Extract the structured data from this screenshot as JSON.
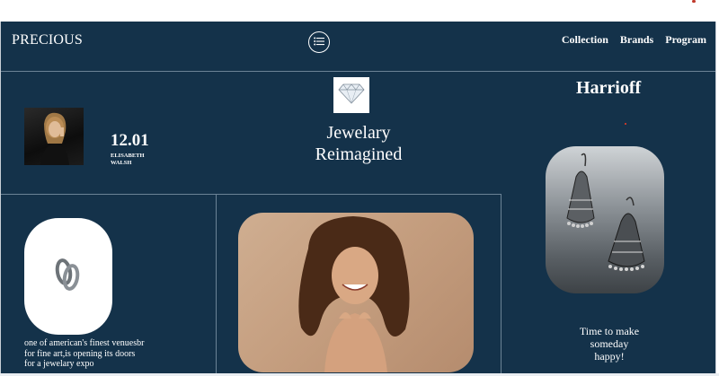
{
  "navbar": {
    "brand": "PRECIOUS",
    "links": [
      "Collection",
      "Brands",
      "Program"
    ]
  },
  "hero": {
    "title_line1": "Jewelary",
    "title_line2": "Reimagined"
  },
  "profile": {
    "number": "12.01",
    "name_line1": "ELISABETH",
    "name_line2": "WALSH"
  },
  "brand_feature": {
    "name": "Harrioff",
    "caption_line1": "Time to make",
    "caption_line2": "someday",
    "caption_line3": "happy!"
  },
  "ring_feature": {
    "caption_line1": "one of american's finest venuesbr",
    "caption_line2": "for fine art,is opening its doors",
    "caption_line3": "for a jewelary expo"
  },
  "colors": {
    "background": "#14324a",
    "text": "#ffffff",
    "divider": "#6b8396"
  },
  "icons": [
    "menu-icon",
    "diamond-icon",
    "ring-icon",
    "earring-image",
    "portrait-image",
    "woman-photo"
  ]
}
